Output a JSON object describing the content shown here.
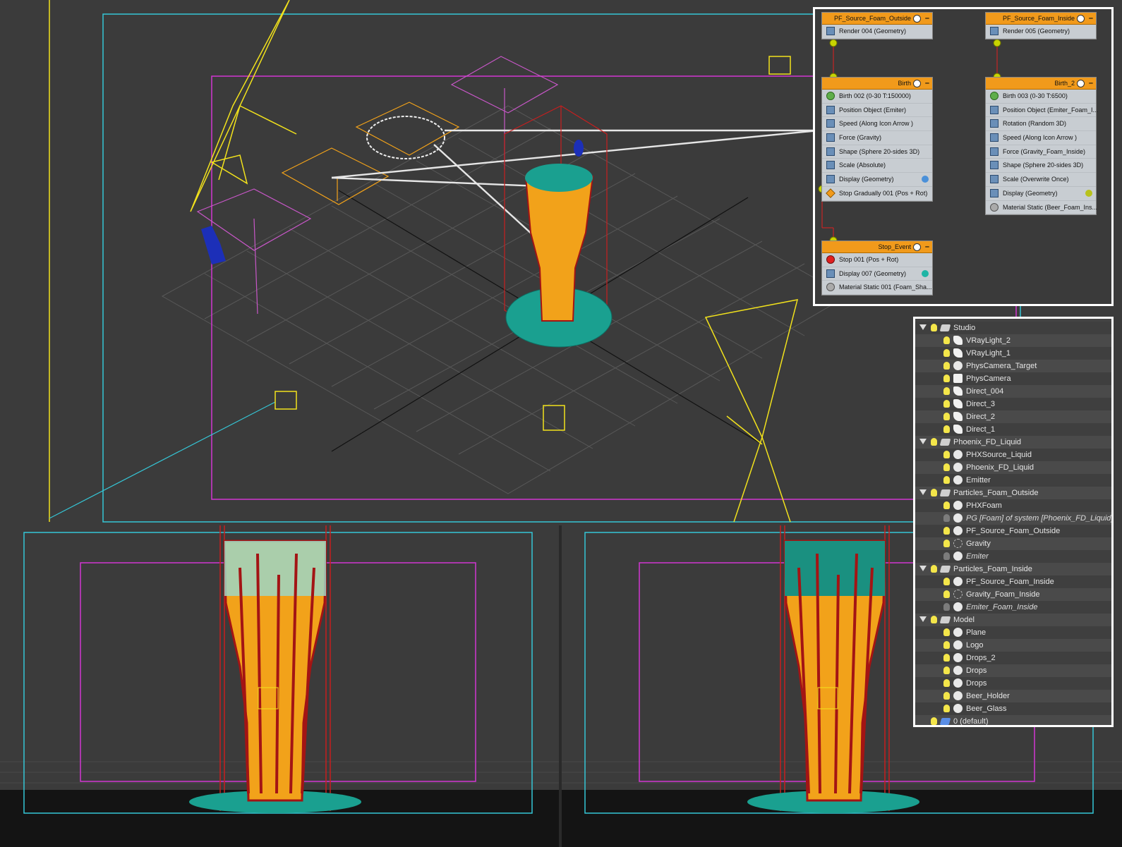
{
  "colors": {
    "viewport_bg": "#3b3b3b",
    "grid": "#5a5a5a",
    "camera_yellow": "#f2e21c",
    "safe_frame_cyan": "#35c6d6",
    "safe_frame_magenta": "#d236d2",
    "beer_orange": "#f2a21a",
    "foam_teal": "#1aa090",
    "bubble_red": "#a31414",
    "node_header_orange": "#f19a1b"
  },
  "particle_view": {
    "nodes": [
      {
        "id": "pf-source-outside",
        "title": "PF_Source_Foam_Outside",
        "rows": [
          {
            "label": "Render 004 (Geometry)",
            "icon": "render-icon"
          }
        ]
      },
      {
        "id": "pf-source-inside",
        "title": "PF_Source_Foam_Inside",
        "rows": [
          {
            "label": "Render 005 (Geometry)",
            "icon": "render-icon"
          }
        ]
      },
      {
        "id": "birth",
        "title": "Birth",
        "rows": [
          {
            "label": "Birth 002 (0-30 T:150000)",
            "icon": "birth-icon"
          },
          {
            "label": "Position Object (Emiter)",
            "icon": "position-icon"
          },
          {
            "label": "Speed (Along Icon Arrow )",
            "icon": "speed-icon"
          },
          {
            "label": "Force (Gravity)",
            "icon": "force-icon"
          },
          {
            "label": "Shape (Sphere 20-sides 3D)",
            "icon": "shape-icon"
          },
          {
            "label": "Scale (Absolute)",
            "icon": "scale-icon"
          },
          {
            "label": "Display (Geometry)",
            "icon": "display-icon",
            "dot": "#4a90d9"
          },
          {
            "label": "Stop Gradually 001 (Pos + Rot)",
            "icon": "stop-gradually-icon"
          }
        ]
      },
      {
        "id": "birth-2",
        "title": "Birth_2",
        "rows": [
          {
            "label": "Birth 003 (0-30 T:6500)",
            "icon": "birth-icon"
          },
          {
            "label": "Position Object (Emiter_Foam_I...",
            "icon": "position-icon"
          },
          {
            "label": "Rotation (Random 3D)",
            "icon": "rotation-icon"
          },
          {
            "label": "Speed (Along Icon Arrow )",
            "icon": "speed-icon"
          },
          {
            "label": "Force (Gravity_Foam_Inside)",
            "icon": "force-icon"
          },
          {
            "label": "Shape (Sphere 20-sides 3D)",
            "icon": "shape-icon"
          },
          {
            "label": "Scale (Overwrite Once)",
            "icon": "scale-icon"
          },
          {
            "label": "Display (Geometry)",
            "icon": "display-icon",
            "dot": "#b8c21c"
          },
          {
            "label": "Material Static (Beer_Foam_Ins...",
            "icon": "material-icon"
          }
        ]
      },
      {
        "id": "stop-event",
        "title": "Stop_Event",
        "rows": [
          {
            "label": "Stop 001 (Pos + Rot)",
            "icon": "stop-icon"
          },
          {
            "label": "Display 007 (Geometry)",
            "icon": "display-icon",
            "dot": "#1fb5a5"
          },
          {
            "label": "Material Static 001 (Foam_Sha...",
            "icon": "material-icon"
          }
        ]
      }
    ]
  },
  "scene_explorer": {
    "rows": [
      {
        "label": "Studio",
        "level": 0,
        "type": "layer",
        "expanded": true,
        "light": "on"
      },
      {
        "label": "VRayLight_2",
        "level": 1,
        "type": "light",
        "light": "on"
      },
      {
        "label": "VRayLight_1",
        "level": 1,
        "type": "light",
        "light": "on"
      },
      {
        "label": "PhysCamera_Target",
        "level": 1,
        "type": "object",
        "light": "on"
      },
      {
        "label": "PhysCamera",
        "level": 1,
        "type": "camera",
        "light": "on"
      },
      {
        "label": "Direct_004",
        "level": 1,
        "type": "light",
        "light": "on"
      },
      {
        "label": "Direct_3",
        "level": 1,
        "type": "light",
        "light": "on"
      },
      {
        "label": "Direct_2",
        "level": 1,
        "type": "light",
        "light": "on"
      },
      {
        "label": "Direct_1",
        "level": 1,
        "type": "light",
        "light": "on"
      },
      {
        "label": "Phoenix_FD_Liquid",
        "level": 0,
        "type": "layer",
        "expanded": true,
        "light": "on"
      },
      {
        "label": "PHXSource_Liquid",
        "level": 1,
        "type": "object",
        "light": "on"
      },
      {
        "label": "Phoenix_FD_Liquid",
        "level": 1,
        "type": "object",
        "light": "on"
      },
      {
        "label": "Emitter",
        "level": 1,
        "type": "object",
        "light": "on"
      },
      {
        "label": "Particles_Foam_Outside",
        "level": 0,
        "type": "layer",
        "expanded": true,
        "light": "on"
      },
      {
        "label": "PHXFoam",
        "level": 1,
        "type": "object",
        "light": "on"
      },
      {
        "label": "PG [Foam] of system [Phoenix_FD_Liquid]",
        "level": 1,
        "type": "object",
        "light": "off",
        "italic": true
      },
      {
        "label": "PF_Source_Foam_Outside",
        "level": 1,
        "type": "object",
        "light": "on"
      },
      {
        "label": "Gravity",
        "level": 1,
        "type": "ghost",
        "light": "on"
      },
      {
        "label": "Emiter",
        "level": 1,
        "type": "object",
        "light": "off",
        "italic": true
      },
      {
        "label": "Particles_Foam_Inside",
        "level": 0,
        "type": "layer",
        "expanded": true,
        "light": "on"
      },
      {
        "label": "PF_Source_Foam_Inside",
        "level": 1,
        "type": "object",
        "light": "on"
      },
      {
        "label": "Gravity_Foam_Inside",
        "level": 1,
        "type": "ghost",
        "light": "on"
      },
      {
        "label": "Emiter_Foam_Inside",
        "level": 1,
        "type": "object",
        "light": "off",
        "italic": true
      },
      {
        "label": "Model",
        "level": 0,
        "type": "layer",
        "expanded": true,
        "light": "on"
      },
      {
        "label": "Plane",
        "level": 1,
        "type": "object",
        "light": "on"
      },
      {
        "label": "Logo",
        "level": 1,
        "type": "object",
        "light": "on"
      },
      {
        "label": "Drops_2",
        "level": 1,
        "type": "object",
        "light": "on"
      },
      {
        "label": "Drops",
        "level": 1,
        "type": "object",
        "light": "on"
      },
      {
        "label": "Drops",
        "level": 1,
        "type": "object",
        "light": "on"
      },
      {
        "label": "Beer_Holder",
        "level": 1,
        "type": "object",
        "light": "on"
      },
      {
        "label": "Beer_Glass",
        "level": 1,
        "type": "object",
        "light": "on"
      },
      {
        "label": "0 (default)",
        "level": 0,
        "type": "layer-default",
        "light": "on"
      }
    ]
  }
}
